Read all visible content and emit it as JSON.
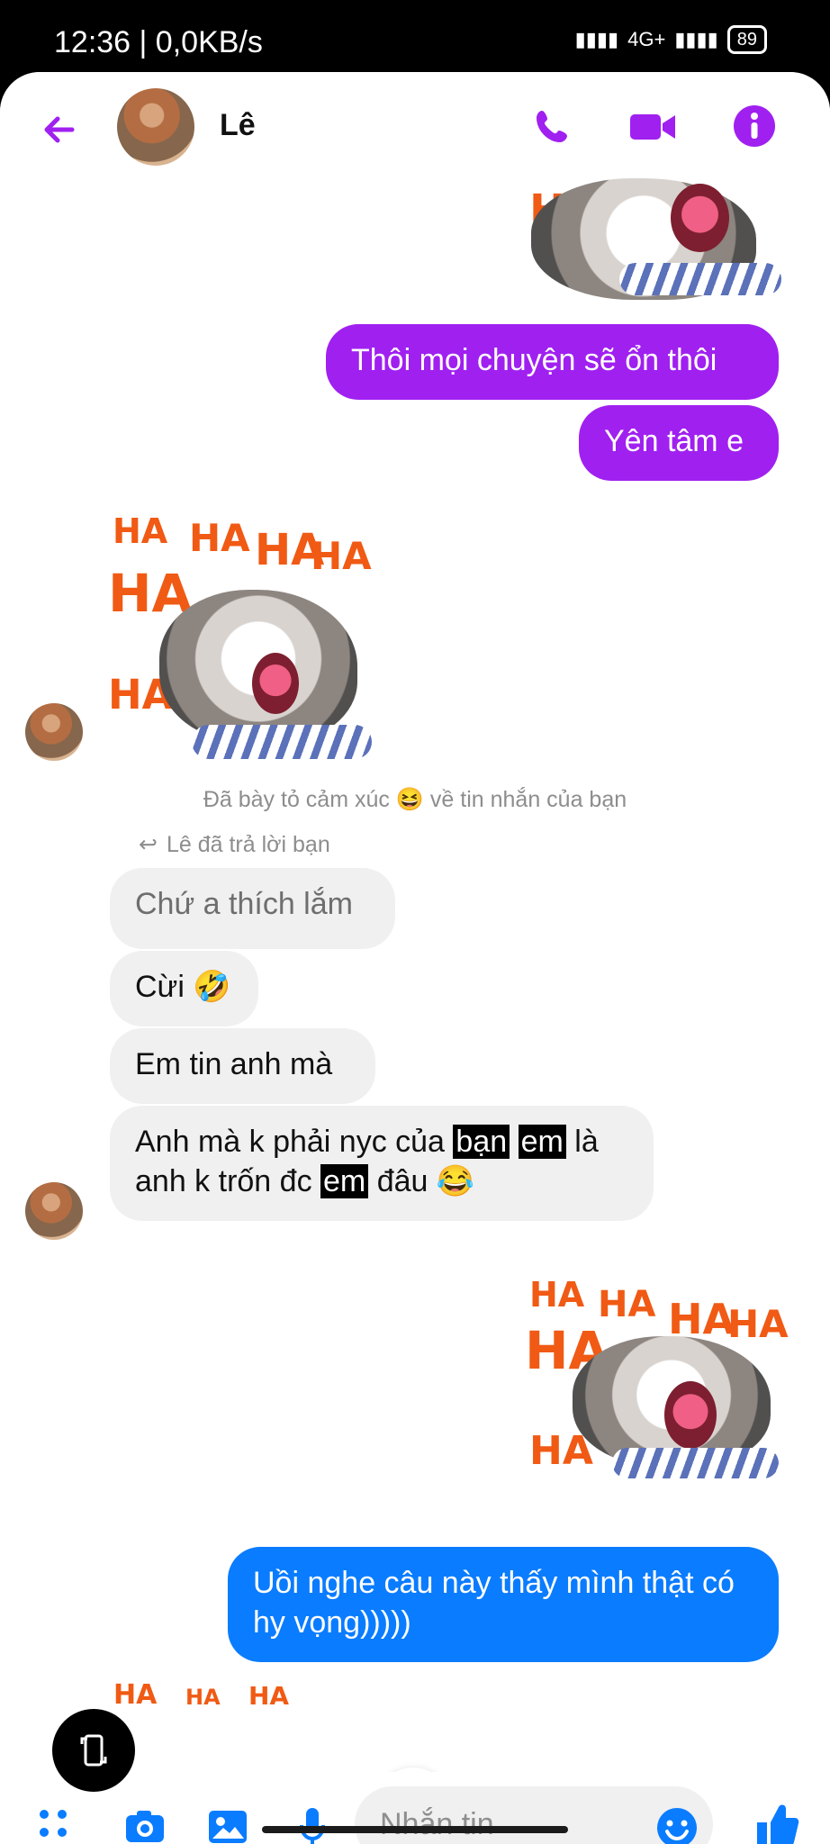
{
  "status_bar": {
    "time_network": "12:36 | 0,0KB/s",
    "network": "4G+",
    "battery": "89"
  },
  "header": {
    "contact_name": "Lê",
    "accent": "#a020f0"
  },
  "messages": {
    "sent_1": "Thôi mọi chuyện sẽ ổn thôi",
    "sent_2": "Yên tâm e",
    "system_reaction_before": "Đã bày tỏ cảm xúc",
    "system_reaction_after": "về tin nhắn của bạn",
    "reply_notice": "Lê đã trả lời bạn",
    "quoted_reply": "Chứ a thích lắm",
    "recv_1": "Cừi",
    "recv_1_emoji": "🤣",
    "recv_2": "Em tin anh mà",
    "recv_3_part1": "Anh mà k phải nyc của ",
    "recv_3_hl1": "bạn",
    "recv_3_space": " ",
    "recv_3_hl2": "em",
    "recv_3_part2": " là",
    "recv_3_line2a": "anh k trốn đc ",
    "recv_3_hl3": "em",
    "recv_3_line2b": " đâu",
    "recv_3_emoji": "😂",
    "sent_last": "Uồi nghe câu này thấy mình thật có hy vọng)))))"
  },
  "sticker": {
    "texts": [
      "HA",
      "HA",
      "HA",
      "HA",
      "HA",
      "HA",
      "HA"
    ]
  },
  "composer": {
    "placeholder": "Nhắn tin",
    "send_color": "#0a7cff"
  }
}
